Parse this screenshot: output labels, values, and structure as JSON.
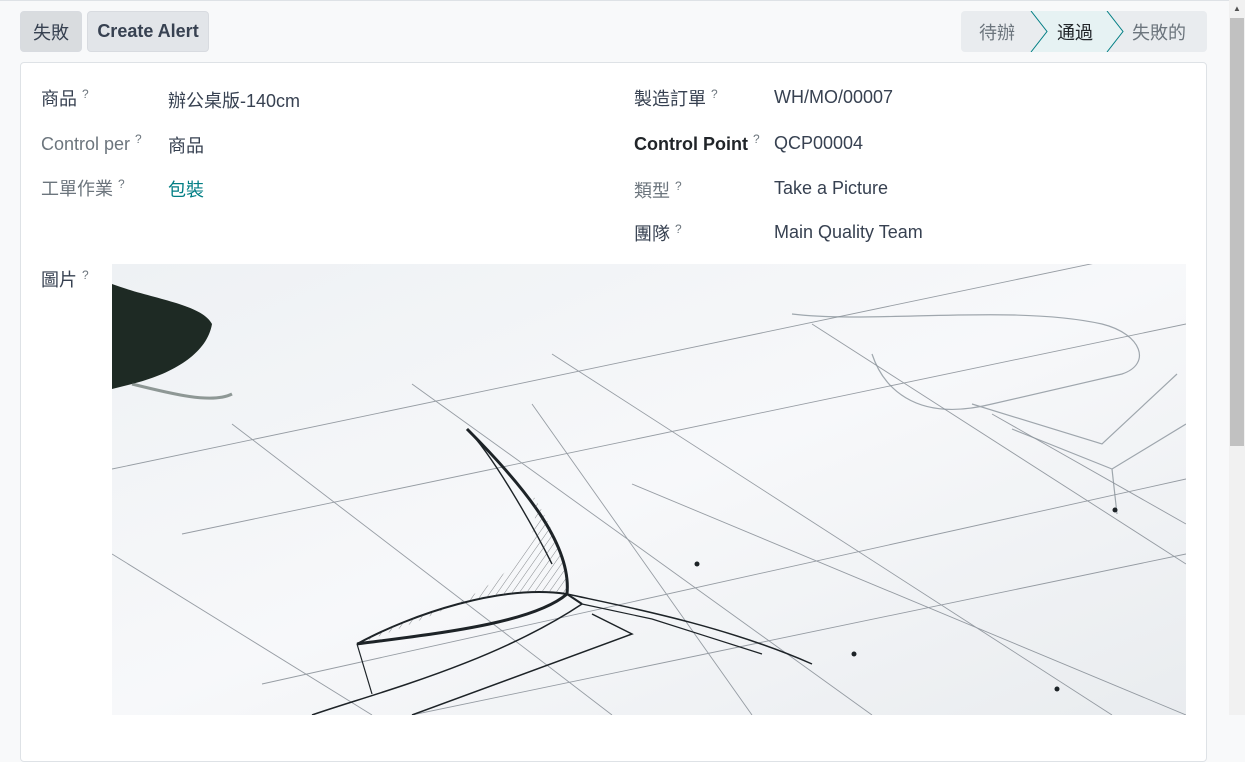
{
  "actions": {
    "fail_label": "失敗",
    "create_alert_label": "Create Alert"
  },
  "statusbar": {
    "stages": [
      "待辦",
      "通過",
      "失敗的"
    ],
    "active": "通過"
  },
  "fields": {
    "product": {
      "label": "商品",
      "value": "辦公桌版-140cm"
    },
    "control_per": {
      "label": "Control per",
      "value": "商品"
    },
    "operation": {
      "label": "工單作業",
      "value": "包裝"
    },
    "manufacturing_order": {
      "label": "製造訂單",
      "value": "WH/MO/00007"
    },
    "control_point": {
      "label": "Control Point",
      "value": "QCP00004"
    },
    "type": {
      "label": "類型",
      "value": "Take a Picture"
    },
    "team": {
      "label": "團隊",
      "value": "Main Quality Team"
    },
    "picture": {
      "label": "圖片"
    }
  },
  "help_mark": "?",
  "colors": {
    "link": "#017e84",
    "active_stage_bg": "#e6f2f3",
    "stage_border": "#017e84"
  }
}
